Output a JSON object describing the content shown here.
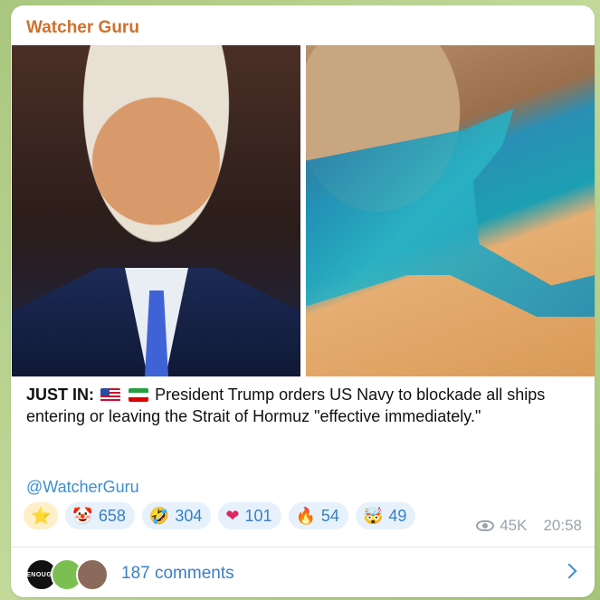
{
  "channel": {
    "name": "Watcher Guru"
  },
  "message": {
    "prefix": "JUST IN:",
    "body": "President Trump orders US Navy to blockade all ships entering or leaving the Strait of Hormuz \"effective immediately.\"",
    "hashtag": "@WatcherGuru",
    "flags": [
      "us-flag-icon",
      "iran-flag-icon"
    ]
  },
  "images": [
    {
      "name": "portrait-photo"
    },
    {
      "name": "satellite-strait-photo"
    }
  ],
  "reactions": [
    {
      "icon": "star-icon",
      "emoji": "⭐",
      "count": ""
    },
    {
      "icon": "clown-icon",
      "emoji": "🤡",
      "count": "658"
    },
    {
      "icon": "laughing-icon",
      "emoji": "🤣",
      "count": "304"
    },
    {
      "icon": "heart-icon",
      "emoji": "❤",
      "count": "101"
    },
    {
      "icon": "fire-icon",
      "emoji": "🔥",
      "count": "54"
    },
    {
      "icon": "exploding-head-icon",
      "emoji": "🤯",
      "count": "49"
    }
  ],
  "meta": {
    "views": "45K",
    "time": "20:58"
  },
  "comments": {
    "label": "187 comments",
    "avatar_text": "ENOUGH"
  },
  "colors": {
    "channel": "#d0712b",
    "link": "#3a8fd0",
    "reaction_bg": "#e6f1fb"
  }
}
